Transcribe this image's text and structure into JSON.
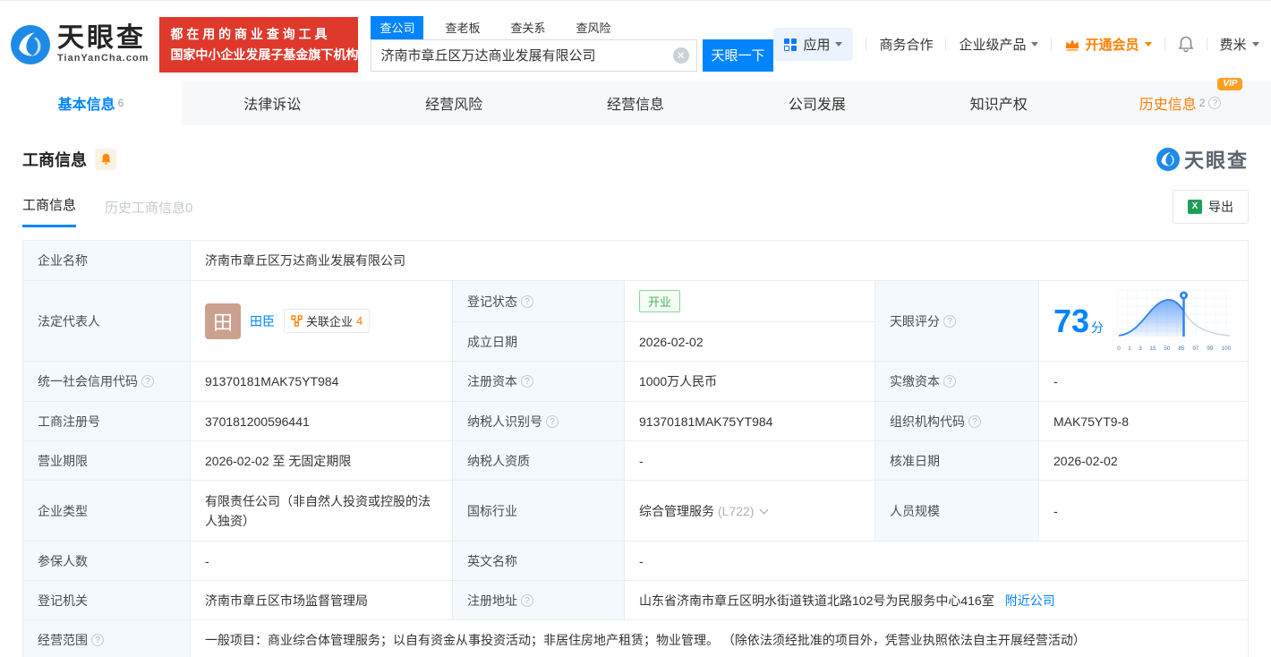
{
  "brand": {
    "name": "天眼查",
    "domain": "TianYanCha.com",
    "slogan_line1": "都 在 用 的 商 业 查 询 工 具",
    "slogan_line2": "国家中小企业发展子基金旗下机构"
  },
  "search": {
    "tabs": [
      {
        "label": "查公司"
      },
      {
        "label": "查老板"
      },
      {
        "label": "查关系"
      },
      {
        "label": "查风险"
      }
    ],
    "value": "济南市章丘区万达商业发展有限公司",
    "button_label": "天眼一下"
  },
  "header_right": {
    "apps_label": "应用",
    "biz_coop": "商务合作",
    "enterprise_product": "企业级产品",
    "vip_label": "开通会员",
    "username": "费米"
  },
  "nav_tabs": [
    {
      "label": "基本信息",
      "count": "6"
    },
    {
      "label": "法律诉讼"
    },
    {
      "label": "经营风险"
    },
    {
      "label": "经营信息"
    },
    {
      "label": "公司发展"
    },
    {
      "label": "知识产权"
    },
    {
      "label": "历史信息",
      "count": "2",
      "vip": "VIP"
    }
  ],
  "section": {
    "title": "工商信息",
    "subtab_active": "工商信息",
    "subtab_history": "历史工商信息0",
    "export_label": "导出",
    "watermark": "天眼查"
  },
  "info": {
    "name": {
      "label": "企业名称",
      "value": "济南市章丘区万达商业发展有限公司"
    },
    "legal": {
      "label": "法定代表人",
      "person": "田臣",
      "avatar": "田",
      "rel_label": "关联企业",
      "rel_count": "4"
    },
    "reg_status": {
      "label": "登记状态",
      "value": "开业"
    },
    "est_date": {
      "label": "成立日期",
      "value": "2026-02-02"
    },
    "score": {
      "label": "天眼评分",
      "value": "73",
      "unit": "分",
      "ticks": [
        "0",
        "1",
        "3",
        "15",
        "50",
        "85",
        "97",
        "99",
        "100"
      ]
    },
    "credit_code": {
      "label": "统一社会信用代码",
      "value": "91370181MAK75YT984"
    },
    "reg_capital": {
      "label": "注册资本",
      "value": "1000万人民币"
    },
    "paid_capital": {
      "label": "实缴资本",
      "value": "-"
    },
    "reg_no": {
      "label": "工商注册号",
      "value": "370181200596441"
    },
    "taxpayer_id": {
      "label": "纳税人识别号",
      "value": "91370181MAK75YT984"
    },
    "org_code": {
      "label": "组织机构代码",
      "value": "MAK75YT9-8"
    },
    "term": {
      "label": "营业期限",
      "value": "2026-02-02 至 无固定期限"
    },
    "taxpayer_quality": {
      "label": "纳税人资质",
      "value": "-"
    },
    "approve_date": {
      "label": "核准日期",
      "value": "2026-02-02"
    },
    "company_type": {
      "label": "企业类型",
      "value": "有限责任公司（非自然人投资或控股的法人独资）"
    },
    "industry": {
      "label": "国标行业",
      "value": "综合管理服务",
      "code": "(L722)"
    },
    "staff_size": {
      "label": "人员规模",
      "value": "-"
    },
    "insured_count": {
      "label": "参保人数",
      "value": "-"
    },
    "english_name": {
      "label": "英文名称",
      "value": "-"
    },
    "reg_authority": {
      "label": "登记机关",
      "value": "济南市章丘区市场监督管理局"
    },
    "address": {
      "label": "注册地址",
      "value": "山东省济南市章丘区明水街道铁道北路102号为民服务中心416室",
      "link": "附近公司"
    },
    "scope": {
      "label": "经营范围",
      "value": "一般项目：商业综合体管理服务；以自有资金从事投资活动；非居住房地产租赁；物业管理。 （除依法须经批准的项目外，凭营业执照依法自主开展经营活动）"
    }
  }
}
